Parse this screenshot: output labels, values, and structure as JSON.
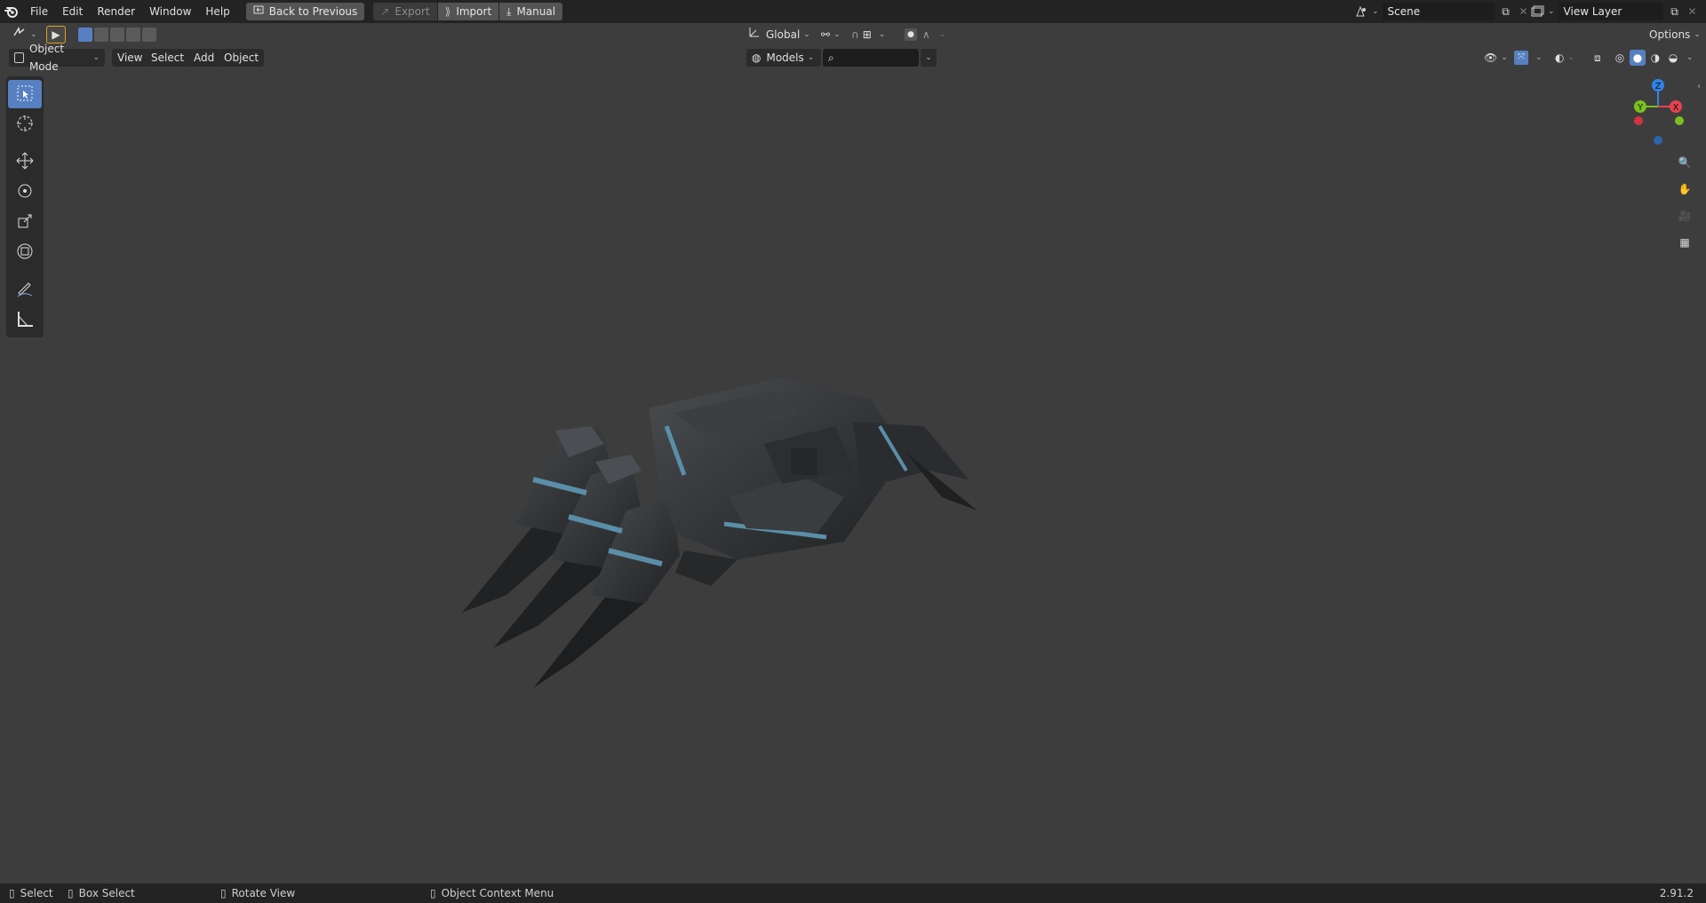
{
  "topbar": {
    "menus": [
      "File",
      "Edit",
      "Render",
      "Window",
      "Help"
    ],
    "back_to_previous": "Back to Previous",
    "export": "Export",
    "import": "Import",
    "manual": "Manual",
    "scene_value": "Scene",
    "view_layer_value": "View Layer"
  },
  "tool_header": {
    "transform_orientation": "Global",
    "options": "Options"
  },
  "view_header": {
    "mode": "Object Mode",
    "menus": [
      "View",
      "Select",
      "Add",
      "Object"
    ],
    "collection": "Models",
    "search_placeholder": ""
  },
  "toolbar": {
    "tools": [
      "select-box",
      "cursor",
      "move",
      "rotate",
      "scale",
      "transform",
      "annotate",
      "measure"
    ],
    "active": "select-box"
  },
  "gizmo": {
    "axes": {
      "x": "X",
      "y": "Y",
      "z": "Z"
    },
    "colors": {
      "x": "#e8424f",
      "y": "#7bbf1f",
      "z": "#2f83e8"
    }
  },
  "statusbar": {
    "select": "Select",
    "box_select": "Box Select",
    "rotate_view": "Rotate View",
    "context_menu": "Object Context Menu",
    "version": "2.91.2"
  },
  "colors": {
    "accent": "#5680c2",
    "viewport_bg": "#3d3d3d",
    "header_bg": "#232323"
  }
}
